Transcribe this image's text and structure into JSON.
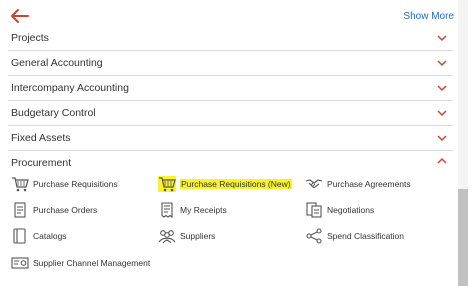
{
  "header": {
    "show_more": "Show More"
  },
  "sections": [
    {
      "label": "Projects"
    },
    {
      "label": "General Accounting"
    },
    {
      "label": "Intercompany Accounting"
    },
    {
      "label": "Budgetary Control"
    },
    {
      "label": "Fixed Assets"
    },
    {
      "label": "Procurement"
    }
  ],
  "procurement": {
    "items": [
      {
        "label": "Purchase Requisitions",
        "icon": "cart-icon"
      },
      {
        "label": "Purchase Requisitions (New)",
        "icon": "cart-icon",
        "highlighted": true
      },
      {
        "label": "Purchase Agreements",
        "icon": "handshake-icon"
      },
      {
        "label": "Purchase Orders",
        "icon": "document-icon"
      },
      {
        "label": "My Receipts",
        "icon": "receipt-icon"
      },
      {
        "label": "Negotiations",
        "icon": "negotiation-icon"
      },
      {
        "label": "Catalogs",
        "icon": "catalog-icon"
      },
      {
        "label": "Suppliers",
        "icon": "suppliers-icon"
      },
      {
        "label": "Spend Classification",
        "icon": "classification-icon"
      },
      {
        "label": "Supplier Channel Management",
        "icon": "channel-icon"
      }
    ]
  },
  "colors": {
    "accent_red": "#c74634",
    "link_blue": "#1f6ebc",
    "highlight": "#f8f32b"
  }
}
